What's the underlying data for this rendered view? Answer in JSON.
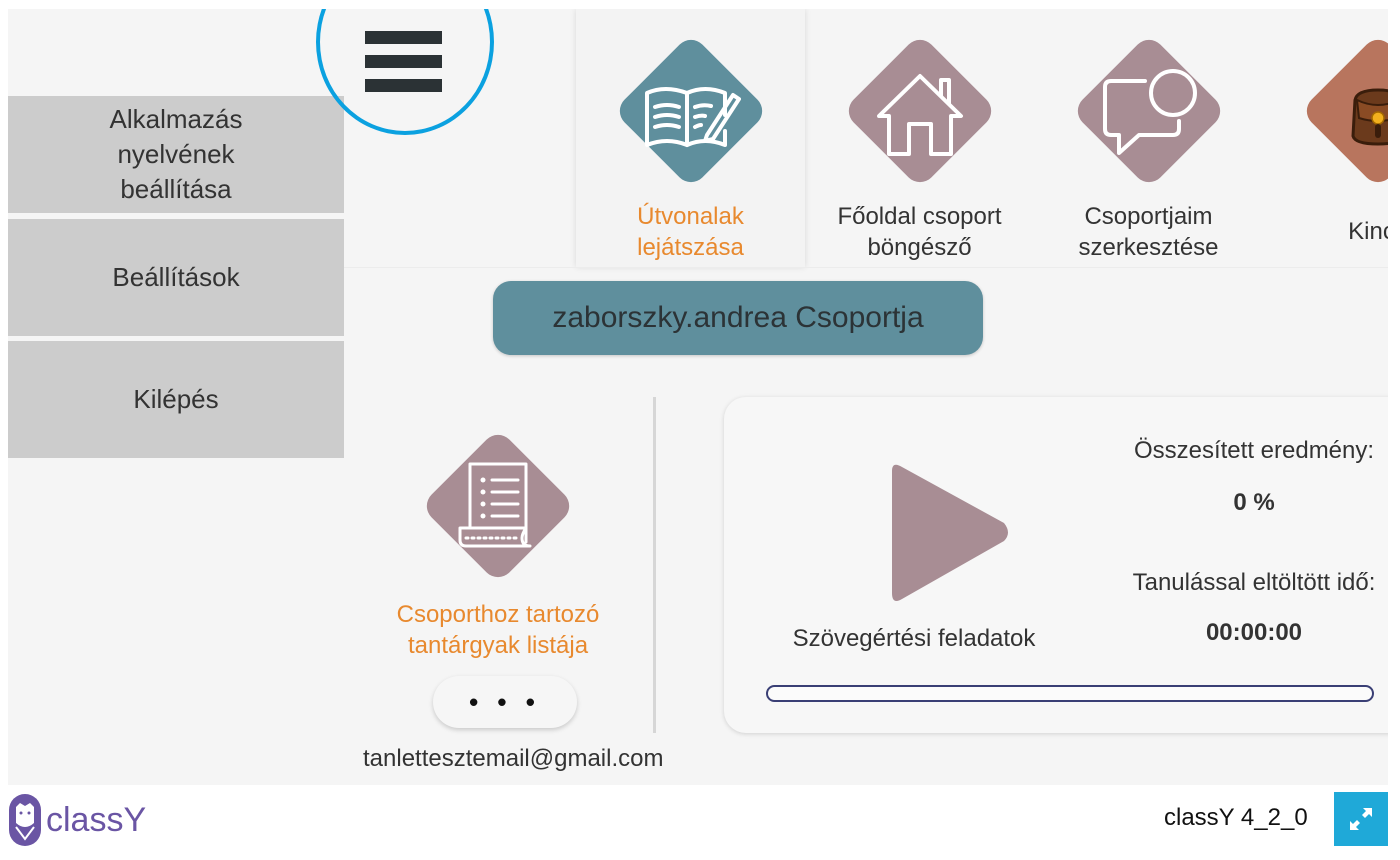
{
  "side_menu": {
    "items": [
      {
        "label": "Alkalmazás nyelvének beállítása"
      },
      {
        "label": "Beállítások"
      },
      {
        "label": "Kilépés"
      }
    ]
  },
  "menu_button": {
    "icon": "hamburger-menu-icon"
  },
  "top_nav": {
    "items": [
      {
        "label_line1": "Útvonalak",
        "label_line2": "lejátszása",
        "icon": "book-pencil-icon",
        "color": "#5f8f9d",
        "active": true
      },
      {
        "label_line1": "Főoldal csoport",
        "label_line2": "böngésző",
        "icon": "home-icon",
        "color": "#a88d94",
        "active": false
      },
      {
        "label_line1": "Csoportjaim",
        "label_line2": "szerkesztése",
        "icon": "chat-bubble-icon",
        "color": "#a88d94",
        "active": false
      },
      {
        "label_line1": "Kincs",
        "label_line2": "",
        "icon": "treasure-bag-icon",
        "color": "#b8755e",
        "active": false
      }
    ]
  },
  "group": {
    "title": "zaborszky.andrea Csoportja"
  },
  "subjects": {
    "item": {
      "label_line1": "Csoporthoz tartozó",
      "label_line2": "tantárgyak listája",
      "icon": "list-scroll-icon"
    },
    "more_label": "• • •",
    "user_email": "tanlettesztemail@gmail.com"
  },
  "course": {
    "title": "Szövegértési feladatok",
    "score_label": "Összesített eredmény:",
    "score_value": "0 %",
    "time_label": "Tanulással eltöltött idő:",
    "time_value": "00:00:00",
    "progress_percent": 0
  },
  "footer": {
    "logo_text": "classY",
    "version": "classY 4_2_0",
    "fullscreen_icon": "expand-arrows-icon"
  },
  "colors": {
    "accent_orange": "#e8892e",
    "teal": "#5f8f9d",
    "mauve": "#a88d94",
    "highlight_ring": "#0ba1e0",
    "fullscreen_bg": "#1fa9d8",
    "progress_border": "#3a3f75"
  }
}
